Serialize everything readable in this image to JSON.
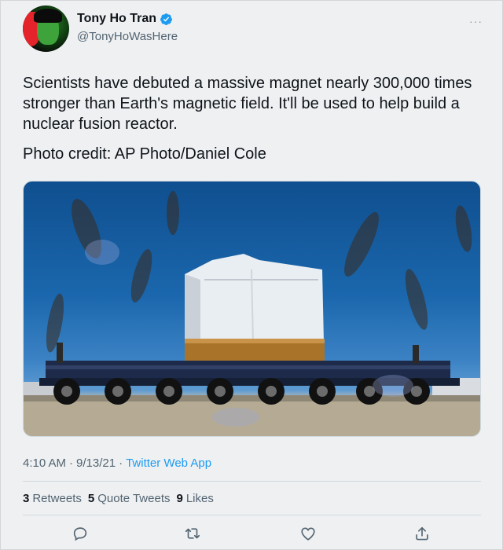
{
  "author": {
    "name": "Tony Ho Tran",
    "handle": "@TonyHoWasHere",
    "verified": true
  },
  "more_label": "···",
  "tweet": {
    "text": "Scientists have debuted a massive magnet nearly 300,000 times stronger than Earth's magnetic field. It'll be used to help build a nuclear fusion reactor.",
    "credit": "Photo credit: AP Photo/Daniel Cole"
  },
  "meta": {
    "time": "4:10 AM",
    "date": "9/13/21",
    "separator": "·",
    "app": "Twitter Web App"
  },
  "stats": {
    "retweets_count": "3",
    "retweets_label": "Retweets",
    "quote_count": "5",
    "quote_label": "Quote Tweets",
    "likes_count": "9",
    "likes_label": "Likes"
  },
  "actions": [
    "reply-icon",
    "retweet-icon",
    "like-icon",
    "share-icon"
  ],
  "colors": {
    "link": "#1d9bf0",
    "verified": "#1d9bf0",
    "secondary_text": "#536471"
  }
}
